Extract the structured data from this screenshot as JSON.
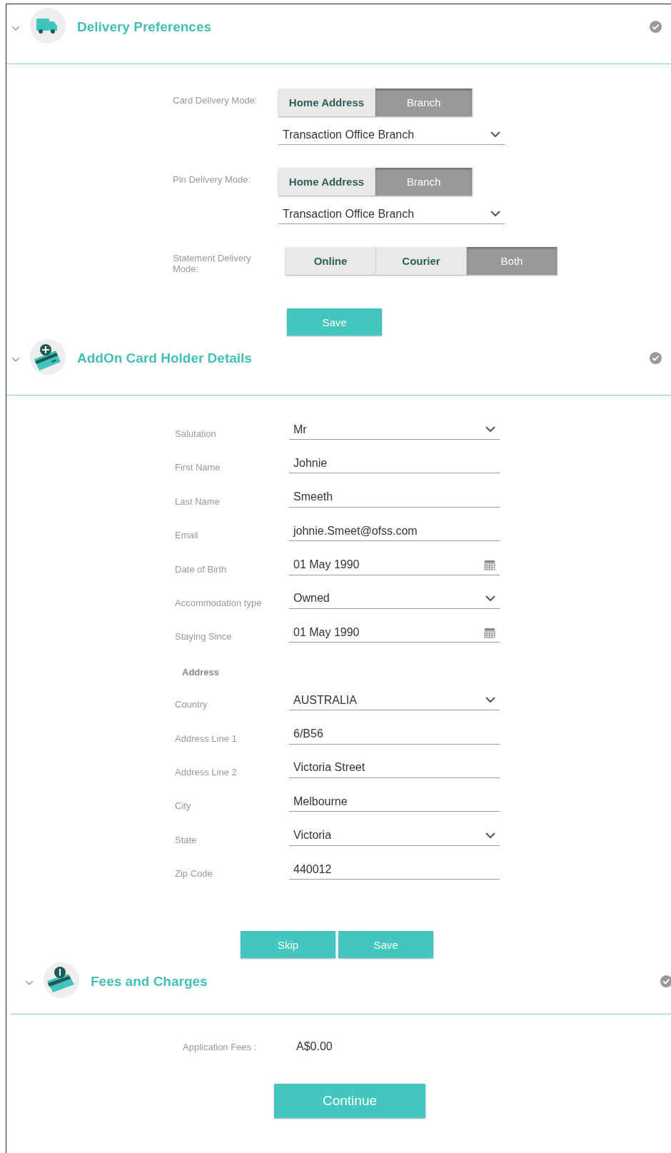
{
  "delivery_preferences": {
    "title": "Delivery Preferences",
    "groups": [
      {
        "label": "Card Delivery Mode:",
        "options": [
          {
            "label": "Home Address",
            "selected": false
          },
          {
            "label": "Branch",
            "selected": true
          }
        ],
        "dropdown": {
          "value": "Transaction Office Branch"
        }
      },
      {
        "label": "Pin Delivery Mode:",
        "options": [
          {
            "label": "Home Address",
            "selected": false
          },
          {
            "label": "Branch",
            "selected": true
          }
        ],
        "dropdown": {
          "value": "Transaction Office Branch"
        }
      },
      {
        "label": "Statement Delivery Mode:",
        "options": [
          {
            "label": "Online",
            "selected": false
          },
          {
            "label": "Courier",
            "selected": false
          },
          {
            "label": "Both",
            "selected": true
          }
        ]
      }
    ],
    "buttons": [
      "Save"
    ]
  },
  "addon_card_holder": {
    "title": "AddOn Card Holder Details",
    "fields": [
      {
        "kind": "select",
        "label": "Salutation",
        "value": "Mr"
      },
      {
        "kind": "text",
        "label": "First Name",
        "value": "Johnie"
      },
      {
        "kind": "text",
        "label": "Last Name",
        "value": "Smeeth"
      },
      {
        "kind": "text",
        "label": "Email",
        "value": "johnie.Smeet@ofss.com"
      },
      {
        "kind": "date",
        "label": "Date of Birth",
        "value": "01 May 1990"
      },
      {
        "kind": "select",
        "label": "Accommodation type",
        "value": "Owned"
      },
      {
        "kind": "date",
        "label": "Staying Since",
        "value": "01 May 1990"
      },
      {
        "kind": "heading",
        "label": "Address"
      },
      {
        "kind": "select",
        "label": "Country",
        "value": "AUSTRALIA"
      },
      {
        "kind": "text",
        "label": "Address Line 1",
        "value": "6/B56"
      },
      {
        "kind": "text",
        "label": "Address Line 2",
        "value": "Victoria Street"
      },
      {
        "kind": "text",
        "label": "City",
        "value": "Melbourne"
      },
      {
        "kind": "select",
        "label": "State",
        "value": "Victoria"
      },
      {
        "kind": "text",
        "label": "Zip Code",
        "value": "440012"
      }
    ],
    "buttons": [
      "Skip",
      "Save"
    ]
  },
  "fees_and_charges": {
    "title": "Fees and Charges",
    "fees": [
      {
        "label": "Application Fees :",
        "value": "A$0.00"
      }
    ],
    "buttons": [
      "Continue"
    ]
  }
}
